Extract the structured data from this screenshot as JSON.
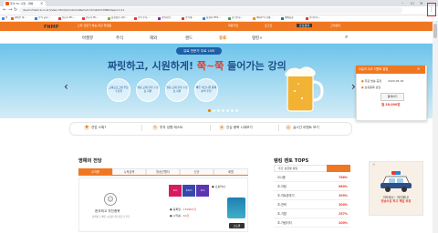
{
  "browser": {
    "tab_title": "주식 TV 시청 - 대박",
    "url": "daum.fnstock.co.kr/index.htm?pmode=lst&mid=ntm&tid=MN01&qno=11",
    "bookmarks": [
      {
        "label": "앱",
        "color": "#4285f4"
      },
      {
        "label": "대박주 아...",
        "color": "#e85a1b"
      },
      {
        "label": "주식 공시...",
        "color": "#1e88e5"
      },
      {
        "label": "전문가 PC...",
        "color": "#e53935"
      },
      {
        "label": "전문가 PC...",
        "color": "#e53935"
      },
      {
        "label": "증권정보 지수...",
        "color": "#7cb342"
      },
      {
        "label": "주식 투자...",
        "color": "#e53935"
      },
      {
        "label": "관심기업...",
        "color": "#8e24aa"
      },
      {
        "label": "주식개...",
        "color": "#e53935"
      },
      {
        "label": "증권사 HTS...",
        "color": "#1e88e5"
      },
      {
        "label": "한국투자...",
        "color": "#43a047"
      },
      {
        "label": "해외주식 현재...",
        "color": "#fb8c00"
      },
      {
        "label": "매매동향",
        "color": "#00897b"
      },
      {
        "label": "우리투자...",
        "color": "#e53935"
      }
    ],
    "menu_icon": "kebab-menu-icon"
  },
  "site": {
    "top_links": [
      "스타 전문가 방송 최강 플랫폼",
      "회원가입",
      "로그인",
      "유료결제",
      "고객센터"
    ],
    "logo_text": "FNMP",
    "logo_sub": "스탁",
    "nav": [
      {
        "label": "마켓뷰",
        "active": false
      },
      {
        "label": "주식",
        "active": false
      },
      {
        "label": "해외",
        "active": false
      },
      {
        "label": "랜드",
        "active": false
      },
      {
        "label": "유료",
        "active": true
      },
      {
        "label": "랭킹+",
        "active": false
      }
    ]
  },
  "banner": {
    "live_pill": "유료 전문가 무료 LIVE",
    "headline_prefix": "짜릿하고, 시원하게!",
    "headline_highlight": "쭉~쭉",
    "headline_suffix": "들어가는 강의",
    "circles": [
      "교육프로그램 무료 수강권",
      "월정 교재 전자 수강료 지원",
      "월정 교재 전자 수강료 지원",
      "빠른 테크니컬 종목 분석 추천"
    ],
    "prev_arrow": "‹",
    "next_arrow": "›",
    "dot_count": 7,
    "active_dot": 0
  },
  "popup": {
    "header": "오늘의 주요 이벤트 알림",
    "close": "×",
    "rows": [
      {
        "icon": "●",
        "text": "무료 방송 증정",
        "date": "2020.05.18"
      },
      {
        "icon": "●",
        "text": "보유종목 상담",
        "date": ""
      }
    ],
    "badge": "결제하기",
    "price": "월 28,000원"
  },
  "quick_links": [
    {
      "icon": "♥",
      "label": "전업 스톡?"
    },
    {
      "icon": "✎",
      "label": "투자 성향 테스트"
    },
    {
      "icon": "★",
      "label": "관심 종목 시세보기"
    },
    {
      "icon": "◎",
      "label": "실시간 이벤트 보기"
    }
  ],
  "hall_of_fame": {
    "title": "명예의 전당",
    "tabs": [
      {
        "label": "수익률",
        "on": true
      },
      {
        "label": "누적금액",
        "on": false
      },
      {
        "label": "방송진행자",
        "on": false
      },
      {
        "label": "신규",
        "on": false
      },
      {
        "label": "회원",
        "on": false
      }
    ],
    "avatar_glyph": "☺",
    "name": "한국최고 추천종목",
    "desc": "정확하고 빠른 시장분석과 전문가 추천",
    "books": [
      {
        "label": "1m",
        "color": "#d81b60"
      },
      {
        "label": "10m",
        "color": "#3949ab"
      },
      {
        "label": "1m",
        "color": "#5e35b1"
      }
    ],
    "tag": "● 오호라씨",
    "stats": [
      {
        "label": "● 등록일 :",
        "value": "152902건"
      },
      {
        "label": "● 수익률 :",
        "value": "64건"
      }
    ],
    "card_btn": "오토워"
  },
  "ranking": {
    "title": "랭킹 멘토 TOPS",
    "head": "주간 상금랭 랭킹",
    "rows": [
      {
        "name": "오시윤",
        "value": "788%"
      },
      {
        "name": "초.이팅",
        "value": "680%"
      },
      {
        "name": "초.차트맞추기",
        "value": "399%"
      },
      {
        "name": "초.전략",
        "value": "300%"
      },
      {
        "name": "초.기법",
        "value": "257%"
      },
      {
        "name": "초.가림이지",
        "value": "200%"
      }
    ]
  },
  "side_ad": {
    "close": "×",
    "line1": "어도비나~ 어디에나!",
    "line2": "방송수강 최고 책임 보장"
  }
}
